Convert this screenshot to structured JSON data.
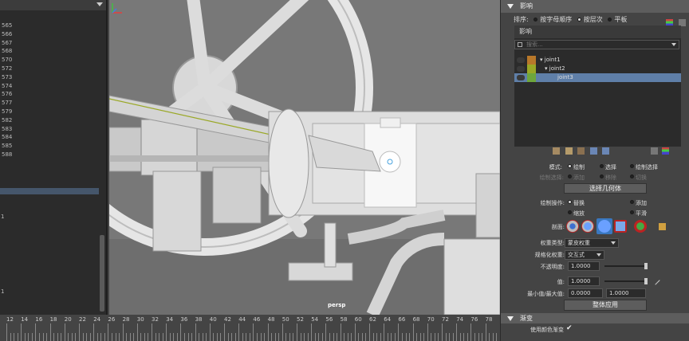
{
  "outliner": {
    "numbers": [
      "565",
      "566",
      "567",
      "568",
      "570",
      "572",
      "573",
      "574",
      "576",
      "577",
      "579",
      "582",
      "583",
      "584",
      "585",
      "588"
    ],
    "marker_1": "1",
    "marker_2": "1"
  },
  "viewport": {
    "camera_label": "persp"
  },
  "attribute_editor": {
    "section_title": "影响",
    "sort_label": "排序:",
    "sort_options": [
      {
        "label": "按字母顺序",
        "selected": false
      },
      {
        "label": "按层次",
        "selected": true
      },
      {
        "label": "平板",
        "selected": false
      }
    ],
    "influence_title": "影响",
    "search_placeholder": "搜索...",
    "joints": [
      {
        "name": "joint1",
        "color": "#b8782a",
        "selected": false,
        "depth": 0
      },
      {
        "name": "joint2",
        "color": "#9aa826",
        "selected": false,
        "depth": 1
      },
      {
        "name": "joint3",
        "color": "#6ea63c",
        "selected": true,
        "depth": 2
      }
    ],
    "mode_label": "模式:",
    "mode_options": [
      {
        "label": "绘制",
        "selected": true
      },
      {
        "label": "选择",
        "selected": false
      },
      {
        "label": "绘制选择",
        "selected": false
      }
    ],
    "paint_select_label": "绘制选择:",
    "paint_select_options": [
      "添加",
      "移除",
      "切换"
    ],
    "select_geometry_button": "选择几何体",
    "paint_op_label": "绘制操作:",
    "paint_ops": [
      {
        "label": "替换",
        "selected": true
      },
      {
        "label": "添加",
        "selected": false
      },
      {
        "label": "缩放",
        "selected": false
      },
      {
        "label": "平滑",
        "selected": false
      }
    ],
    "profile_label": "剖面:",
    "weight_type_label": "权重类型:",
    "weight_type_value": "蒙皮权重",
    "normalize_label": "规格化权重:",
    "normalize_value": "交互式",
    "opacity_label": "不透明度:",
    "opacity_value": "1.0000",
    "value_label": "值:",
    "value_value": "1.0000",
    "minmax_label": "最小值/最大值:",
    "min_value": "0.0000",
    "max_value": "1.0000",
    "flood_button": "整体应用",
    "gradient_section": "渐变",
    "use_color_ramp_label": "使用颜色渐变",
    "use_color_ramp_checked": true
  },
  "timeline": {
    "ticks": [
      "12",
      "14",
      "16",
      "18",
      "20",
      "22",
      "24",
      "26",
      "28",
      "30",
      "32",
      "34",
      "36",
      "38",
      "40",
      "42",
      "44",
      "46",
      "48",
      "50",
      "52",
      "54",
      "56",
      "58",
      "60",
      "62",
      "64",
      "66",
      "68",
      "70",
      "72",
      "74",
      "76",
      "78"
    ]
  },
  "colors": {
    "selection": "#45566b",
    "joint_selected": "#5f7fa8"
  }
}
